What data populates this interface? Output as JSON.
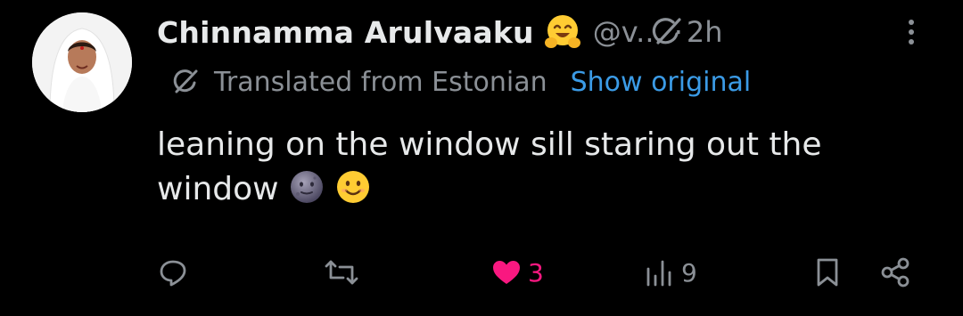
{
  "post": {
    "author_name": "Chinnamma Arulvaaku",
    "handle": "@v...",
    "separator": "·",
    "time": "2h",
    "translation": {
      "label": "Translated from Estonian",
      "link": "Show original"
    },
    "text": "leaning on the window sill staring out the window",
    "actions": {
      "reply_count": "",
      "repost_count": "",
      "like_count": "3",
      "views_count": "9"
    }
  },
  "colors": {
    "background": "#000000",
    "primary_text": "#e7e9ea",
    "secondary_text": "#8b9096",
    "link": "#3b9be6",
    "like": "#f91880"
  },
  "icons": {
    "name_emoji": "hugging-face-emoji",
    "text_emojis": [
      "new-moon-face-emoji",
      "smiling-face-emoji"
    ],
    "header_right": [
      "grok-icon",
      "more-icon"
    ],
    "actions": [
      "reply-icon",
      "repost-icon",
      "like-icon",
      "views-icon",
      "bookmark-icon",
      "share-icon"
    ]
  }
}
